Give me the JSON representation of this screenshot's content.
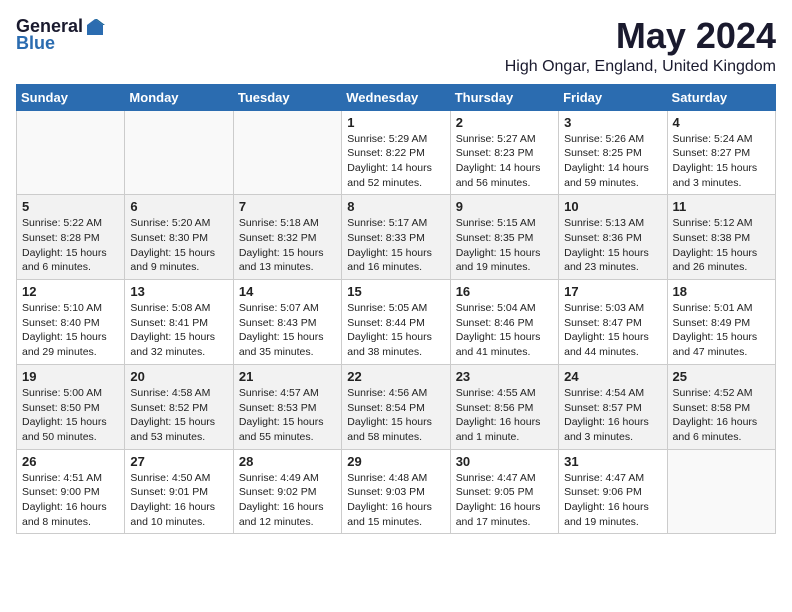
{
  "header": {
    "logo_general": "General",
    "logo_blue": "Blue",
    "month": "May 2024",
    "location": "High Ongar, England, United Kingdom"
  },
  "days_of_week": [
    "Sunday",
    "Monday",
    "Tuesday",
    "Wednesday",
    "Thursday",
    "Friday",
    "Saturday"
  ],
  "weeks": [
    [
      {
        "day": "",
        "detail": ""
      },
      {
        "day": "",
        "detail": ""
      },
      {
        "day": "",
        "detail": ""
      },
      {
        "day": "1",
        "detail": "Sunrise: 5:29 AM\nSunset: 8:22 PM\nDaylight: 14 hours and 52 minutes."
      },
      {
        "day": "2",
        "detail": "Sunrise: 5:27 AM\nSunset: 8:23 PM\nDaylight: 14 hours and 56 minutes."
      },
      {
        "day": "3",
        "detail": "Sunrise: 5:26 AM\nSunset: 8:25 PM\nDaylight: 14 hours and 59 minutes."
      },
      {
        "day": "4",
        "detail": "Sunrise: 5:24 AM\nSunset: 8:27 PM\nDaylight: 15 hours and 3 minutes."
      }
    ],
    [
      {
        "day": "5",
        "detail": "Sunrise: 5:22 AM\nSunset: 8:28 PM\nDaylight: 15 hours and 6 minutes."
      },
      {
        "day": "6",
        "detail": "Sunrise: 5:20 AM\nSunset: 8:30 PM\nDaylight: 15 hours and 9 minutes."
      },
      {
        "day": "7",
        "detail": "Sunrise: 5:18 AM\nSunset: 8:32 PM\nDaylight: 15 hours and 13 minutes."
      },
      {
        "day": "8",
        "detail": "Sunrise: 5:17 AM\nSunset: 8:33 PM\nDaylight: 15 hours and 16 minutes."
      },
      {
        "day": "9",
        "detail": "Sunrise: 5:15 AM\nSunset: 8:35 PM\nDaylight: 15 hours and 19 minutes."
      },
      {
        "day": "10",
        "detail": "Sunrise: 5:13 AM\nSunset: 8:36 PM\nDaylight: 15 hours and 23 minutes."
      },
      {
        "day": "11",
        "detail": "Sunrise: 5:12 AM\nSunset: 8:38 PM\nDaylight: 15 hours and 26 minutes."
      }
    ],
    [
      {
        "day": "12",
        "detail": "Sunrise: 5:10 AM\nSunset: 8:40 PM\nDaylight: 15 hours and 29 minutes."
      },
      {
        "day": "13",
        "detail": "Sunrise: 5:08 AM\nSunset: 8:41 PM\nDaylight: 15 hours and 32 minutes."
      },
      {
        "day": "14",
        "detail": "Sunrise: 5:07 AM\nSunset: 8:43 PM\nDaylight: 15 hours and 35 minutes."
      },
      {
        "day": "15",
        "detail": "Sunrise: 5:05 AM\nSunset: 8:44 PM\nDaylight: 15 hours and 38 minutes."
      },
      {
        "day": "16",
        "detail": "Sunrise: 5:04 AM\nSunset: 8:46 PM\nDaylight: 15 hours and 41 minutes."
      },
      {
        "day": "17",
        "detail": "Sunrise: 5:03 AM\nSunset: 8:47 PM\nDaylight: 15 hours and 44 minutes."
      },
      {
        "day": "18",
        "detail": "Sunrise: 5:01 AM\nSunset: 8:49 PM\nDaylight: 15 hours and 47 minutes."
      }
    ],
    [
      {
        "day": "19",
        "detail": "Sunrise: 5:00 AM\nSunset: 8:50 PM\nDaylight: 15 hours and 50 minutes."
      },
      {
        "day": "20",
        "detail": "Sunrise: 4:58 AM\nSunset: 8:52 PM\nDaylight: 15 hours and 53 minutes."
      },
      {
        "day": "21",
        "detail": "Sunrise: 4:57 AM\nSunset: 8:53 PM\nDaylight: 15 hours and 55 minutes."
      },
      {
        "day": "22",
        "detail": "Sunrise: 4:56 AM\nSunset: 8:54 PM\nDaylight: 15 hours and 58 minutes."
      },
      {
        "day": "23",
        "detail": "Sunrise: 4:55 AM\nSunset: 8:56 PM\nDaylight: 16 hours and 1 minute."
      },
      {
        "day": "24",
        "detail": "Sunrise: 4:54 AM\nSunset: 8:57 PM\nDaylight: 16 hours and 3 minutes."
      },
      {
        "day": "25",
        "detail": "Sunrise: 4:52 AM\nSunset: 8:58 PM\nDaylight: 16 hours and 6 minutes."
      }
    ],
    [
      {
        "day": "26",
        "detail": "Sunrise: 4:51 AM\nSunset: 9:00 PM\nDaylight: 16 hours and 8 minutes."
      },
      {
        "day": "27",
        "detail": "Sunrise: 4:50 AM\nSunset: 9:01 PM\nDaylight: 16 hours and 10 minutes."
      },
      {
        "day": "28",
        "detail": "Sunrise: 4:49 AM\nSunset: 9:02 PM\nDaylight: 16 hours and 12 minutes."
      },
      {
        "day": "29",
        "detail": "Sunrise: 4:48 AM\nSunset: 9:03 PM\nDaylight: 16 hours and 15 minutes."
      },
      {
        "day": "30",
        "detail": "Sunrise: 4:47 AM\nSunset: 9:05 PM\nDaylight: 16 hours and 17 minutes."
      },
      {
        "day": "31",
        "detail": "Sunrise: 4:47 AM\nSunset: 9:06 PM\nDaylight: 16 hours and 19 minutes."
      },
      {
        "day": "",
        "detail": ""
      }
    ]
  ]
}
